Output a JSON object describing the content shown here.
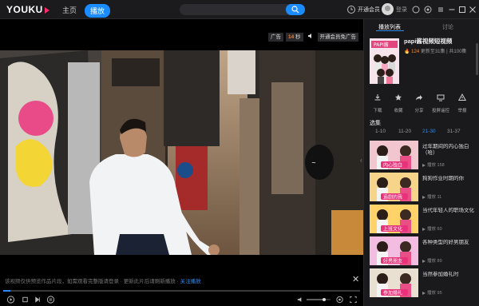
{
  "header": {
    "logo": "YOUKU",
    "nav": {
      "home": "主页",
      "play": "播放"
    },
    "search_placeholder": "",
    "vip_label": "开通会员",
    "login_label": "登录"
  },
  "player": {
    "ad": {
      "label": "广告",
      "countdown": "14",
      "unit": "秒",
      "skip": "开通会员免广告"
    },
    "subtitle_text": "该视频仅供预览作品片段，如需观看完整版请登录 · 更新此片后请刷新播放 · ",
    "subtitle_link": "关注播放",
    "progress": 0.02,
    "colors": {
      "accent": "#2d8cf0",
      "brand": "#1b8cff"
    }
  },
  "sidebar": {
    "tabs": [
      "播放列表",
      "讨论"
    ],
    "show": {
      "title": "papi酱视频短视频",
      "score": "124",
      "meta": "更新至31集 | 共100集",
      "poster_text": "PAPI酱"
    },
    "actions": [
      {
        "icon": "download-icon",
        "label": "下载"
      },
      {
        "icon": "star-icon",
        "label": "收藏"
      },
      {
        "icon": "share-icon",
        "label": "分享"
      },
      {
        "icon": "screen-icon",
        "label": "投屏遥控"
      },
      {
        "icon": "warning-icon",
        "label": "举报"
      }
    ],
    "section_title": "选集",
    "ranges": [
      "1-10",
      "11-20",
      "21-30",
      "31-37"
    ],
    "selected_range": 2,
    "episodes": [
      {
        "title": "过年期间的内心独白（哈）",
        "plays": "播放 158",
        "thumb": "#f1c6cf",
        "caption": "内心独白"
      },
      {
        "title": "狗狗作业时期的你",
        "plays": "播放 11",
        "thumb": "#f6d58a",
        "caption": "追剧的我"
      },
      {
        "title": "当代年轻人的职场文化",
        "plays": "播放 60",
        "thumb": "#ffd36a",
        "caption": "上班文化"
      },
      {
        "title": "各种类型的好男朋友",
        "plays": "播放 89",
        "thumb": "#f2bde0",
        "caption": "好男朋友"
      },
      {
        "title": "当然参加婚礼时",
        "plays": "播放 95",
        "thumb": "#e9e0d2",
        "caption": "参加婚礼"
      }
    ]
  }
}
